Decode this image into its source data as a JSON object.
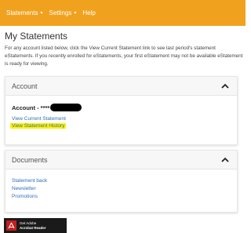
{
  "nav": {
    "items": [
      {
        "label": "Statements",
        "has_caret": true
      },
      {
        "label": "Settings",
        "has_caret": true
      },
      {
        "label": "Help",
        "has_caret": false
      }
    ],
    "caret_glyph": "▾"
  },
  "page": {
    "title": "My Statements",
    "description": "For any account listed below, click the View Current Statement link to see last period's statement eStatements. If you recently enrolled for eStatements, your first eStatement may not be available eStatement is ready for viewing."
  },
  "account_section": {
    "title": "Account",
    "account_label": "Account - ****",
    "links": {
      "current": "View Current Statement",
      "history": "View Statement History"
    }
  },
  "documents_section": {
    "title": "Documents",
    "links": [
      "Statement back",
      "Newsletter",
      "Promotions"
    ]
  },
  "acrobat": {
    "line1": "Get Adobe",
    "line2": "Acrobat Reader"
  },
  "colors": {
    "topbar": "#f0a21f",
    "link": "#2f6fb6",
    "highlight": "#fff200"
  }
}
